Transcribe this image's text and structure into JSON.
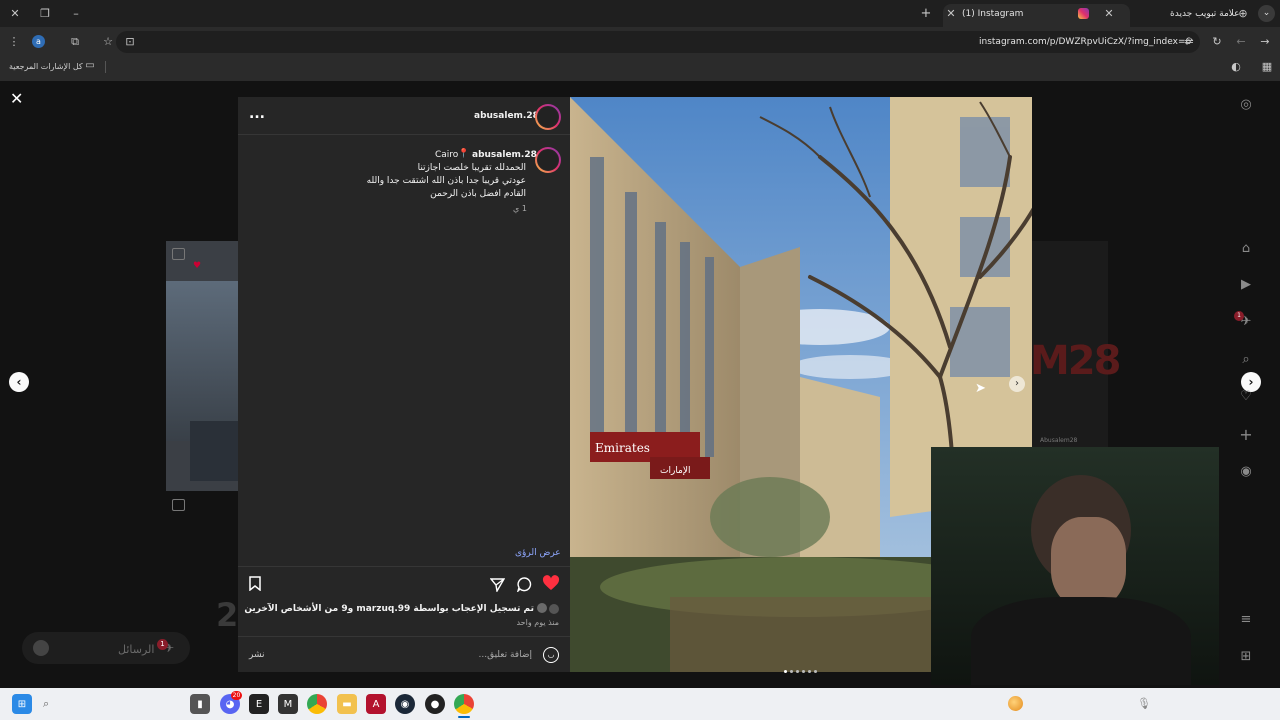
{
  "browser": {
    "tabs": [
      {
        "title": "(1) Instagram",
        "active": true
      },
      {
        "title": "علامة تبويب جديدة",
        "active": false
      }
    ],
    "url": "instagram.com/p/DWZRpvUiCzX/?img_index=6",
    "bookmarks_label": "كل الإشارات المرجعية"
  },
  "post": {
    "username": "abusalem.28",
    "caption_username": "abusalem.28",
    "location": "Cairo",
    "caption_lines": [
      "الحمدلله تقريبا خلصت اجازتنا",
      "عودتي قريبا جدا باذن الله اشتقت جدا والله",
      "القادم افضل باذن الرحمن"
    ],
    "time_short": "1 ي",
    "view_insights": "عرض الرؤى",
    "likes_text": "تم تسجيل الإعجاب بواسطة marzuq.99 و9 من الأشخاص الآخرين",
    "time_ago": "منذ يوم واحد",
    "comment_placeholder": "إضافة تعليق...",
    "post_button": "نشر",
    "more_menu": "..."
  },
  "photo": {
    "storefront_sign_1": "Emirates",
    "storefront_sign_2": "الإمارات",
    "carousel_count": 6,
    "carousel_index": 1
  },
  "background": {
    "messages_label": "الرسائل",
    "messages_badge": "1",
    "notifications_badge": "1",
    "bg_text_left": "2",
    "bg_text_right": "M28",
    "bg_caption": "Abusalem28"
  },
  "taskbar": {
    "icons": [
      "windows-icon",
      "search-icon",
      "file-explorer-icon",
      "discord-icon",
      "epic-games-icon",
      "obs-icon",
      "chrome-icon",
      "folder-icon",
      "app-icon",
      "steam-icon",
      "app2-icon",
      "chrome-active-icon"
    ],
    "discord_badge": "20"
  },
  "colors": {
    "instagram_gradient_start": "#f9c846",
    "instagram_gradient_end": "#833ab4",
    "like_red": "#ff3040",
    "link_blue": "#8fa8ff"
  }
}
